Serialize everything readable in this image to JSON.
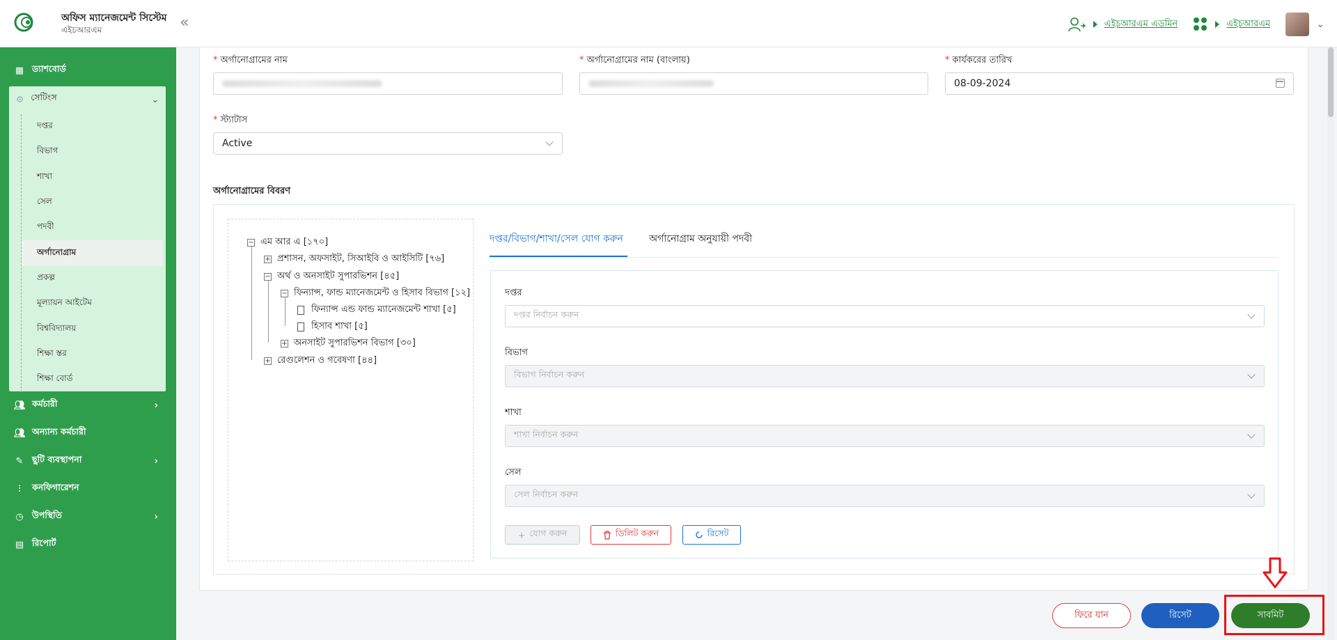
{
  "header": {
    "app_title": "অফিস ম্যানেজমেন্ট সিস্টেম",
    "app_subtitle": "এইচআরএম",
    "role_link": "এইচআরএম এডমিন",
    "module_link": "এইচআরএম",
    "brand_color": "#2e9e4c"
  },
  "sidebar": {
    "dashboard": "ড্যাশবোর্ড",
    "settings": "সেটিংস",
    "settings_items": [
      "দপ্তর",
      "বিভাগ",
      "শাখা",
      "সেল",
      "পদবী",
      "অর্গানোগ্রাম",
      "প্রকল্প",
      "মূল্যায়ন আইটেম",
      "বিশ্ববিদ্যালয়",
      "শিক্ষা স্তর",
      "শিক্ষা বোর্ড"
    ],
    "active_item": "অর্গানোগ্রাম",
    "employee": "কর্মচারী",
    "other_employee": "অন্যান্য কর্মচারী",
    "leave": "ছুটি ব্যবস্থাপনা",
    "configuration": "কনফিগারেশন",
    "attendance": "উপস্থিতি",
    "report": "রিপোর্ট"
  },
  "form": {
    "name_label": "অর্গানোগ্রামের নাম",
    "name_bn_label": "অর্গানোগ্রামের নাম (বাংলায়)",
    "effective_date_label": "কার্যকরের তারিখ",
    "effective_date_value": "08-09-2024",
    "status_label": "স্ট্যাটাস",
    "status_value": "Active",
    "details_title": "অর্গানোগ্রামের বিবরণ"
  },
  "tree": {
    "root": "এম আর এ [১৭০]",
    "n1": "প্রশাসন, অফসাইট, সিআইবি ও আইসিটি [৭৬]",
    "n2": "অর্থ ও অনসাইট সুপারভিশন [৪৫]",
    "n2a": "ফিন্যান্স, ফান্ড ম্যানেজমেন্ট ও হিসাব বিভাগ [১২]",
    "n2a1": "ফিন্যান্স এন্ড ফান্ড ম্যানেজমেন্ট শাখা [৫]",
    "n2a2": "হিসাব শাখা [৫]",
    "n2b": "অনসাইট সুপারভিশন বিভাগ [৩০]",
    "n3": "রেগুলেশন ও গবেষণা [৪৪]"
  },
  "tabs": {
    "add": "দপ্তর/বিভাগ/শাখা/সেল যোগ করুন",
    "designation": "অর্গানোগ্রাম অনুযায়ী পদবী"
  },
  "unit_form": {
    "office_label": "দপ্তর",
    "office_placeholder": "দপ্তর নির্বাচন করুন",
    "dept_label": "বিভাগ",
    "dept_placeholder": "বিভাগ নির্বাচন করুন",
    "branch_label": "শাখা",
    "branch_placeholder": "শাখা নির্বাচন করুন",
    "cell_label": "সেল",
    "cell_placeholder": "সেল নির্বাচন করুন",
    "add_btn": "যোগ করুন",
    "delete_btn": "ডিলিট করুন",
    "reset_btn": "রিসেট"
  },
  "actions": {
    "back": "ফিরে যান",
    "reset": "রিসেট",
    "submit": "সাবমিট"
  }
}
